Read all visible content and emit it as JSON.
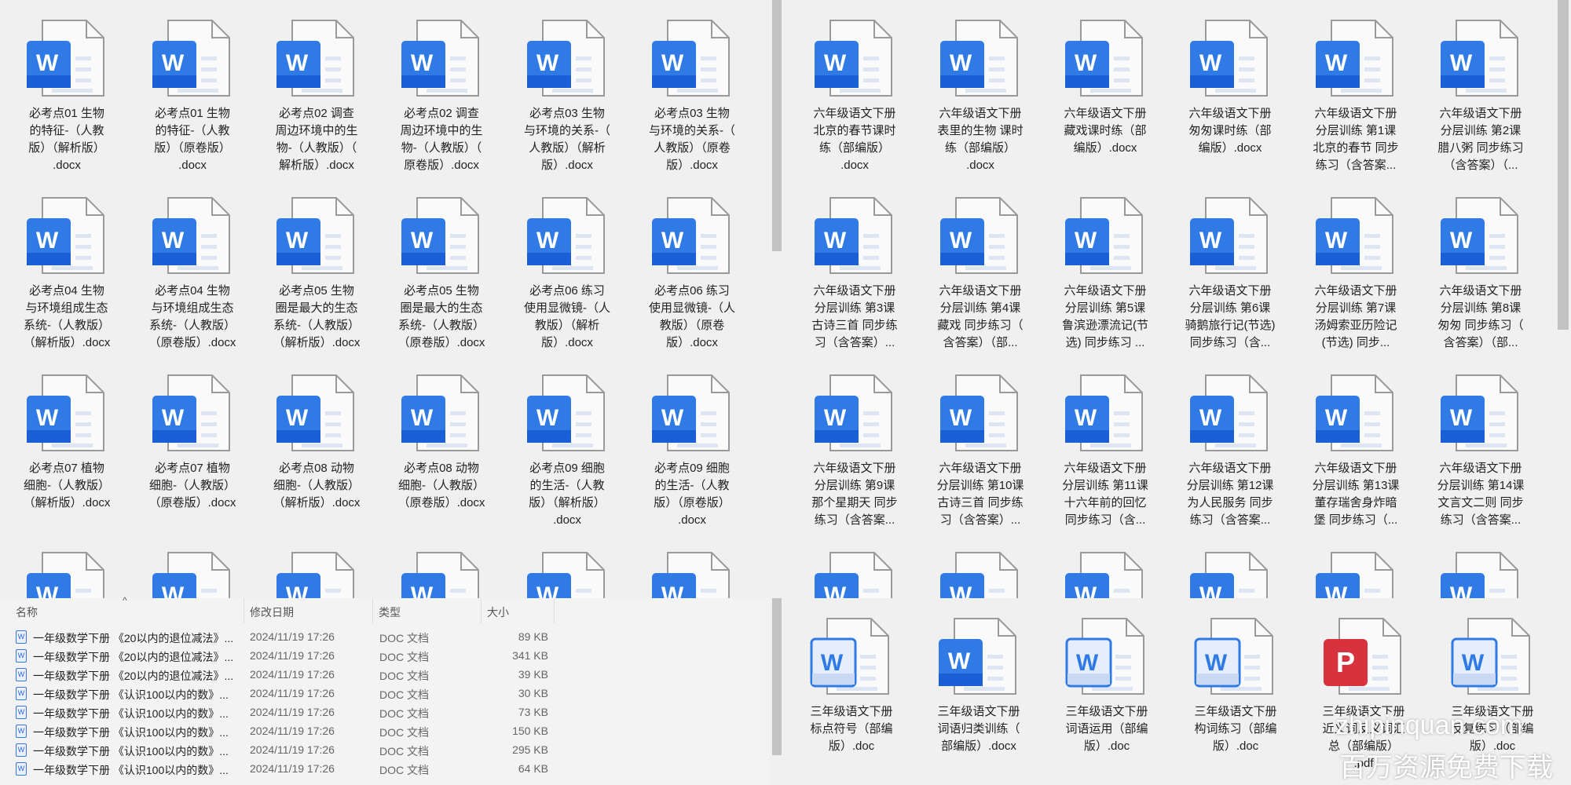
{
  "left_grid": [
    "必考点01  生物\n的特征-（人教\n版）（解析版）\n.docx",
    "必考点01  生物\n的特征-（人教\n版）（原卷版）\n.docx",
    "必考点02  调查\n周边环境中的生\n物-（人教版）（\n解析版）.docx",
    "必考点02  调查\n周边环境中的生\n物-（人教版）（\n原卷版）.docx",
    "必考点03  生物\n与环境的关系-（\n人教版）（解析\n版）.docx",
    "必考点03  生物\n与环境的关系-（\n人教版）（原卷\n版）.docx",
    "必考点04  生物\n与环境组成生态\n系统-（人教版）\n（解析版）.docx",
    "必考点04  生物\n与环境组成生态\n系统-（人教版）\n（原卷版）.docx",
    "必考点05  生物\n圈是最大的生态\n系统-（人教版）\n（解析版）.docx",
    "必考点05  生物\n圈是最大的生态\n系统-（人教版）\n（原卷版）.docx",
    "必考点06  练习\n使用显微镜-（人\n教版）（解析\n版）.docx",
    "必考点06  练习\n使用显微镜-（人\n教版）（原卷\n版）.docx",
    "必考点07  植物\n细胞-（人教版）\n（解析版）.docx",
    "必考点07  植物\n细胞-（人教版）\n（原卷版）.docx",
    "必考点08  动物\n细胞-（人教版）\n（解析版）.docx",
    "必考点08  动物\n细胞-（人教版）\n（原卷版）.docx",
    "必考点09  细胞\n的生活-（人教\n版）（解析版）\n.docx",
    "必考点09  细胞\n的生活-（人教\n版）（原卷版）\n.docx",
    "",
    "",
    "",
    "",
    "",
    ""
  ],
  "right_grid": [
    "六年级语文下册\n北京的春节课时\n练（部编版）\n.docx",
    "六年级语文下册\n表里的生物 课时\n练（部编版）\n.docx",
    "六年级语文下册\n藏戏课时练（部\n编版）.docx",
    "六年级语文下册\n匆匆课时练（部\n编版）.docx",
    "六年级语文下册\n分层训练 第1课\n北京的春节 同步\n练习（含答案...",
    "六年级语文下册\n分层训练 第2课\n腊八粥 同步练习\n（含答案）（...",
    "六年级语文下册\n分层训练 第3课\n古诗三首 同步练\n习（含答案）...",
    "六年级语文下册\n分层训练 第4课\n藏戏 同步练习（\n含答案）（部...",
    "六年级语文下册\n分层训练 第5课\n鲁滨逊漂流记(节\n选) 同步练习 ...",
    "六年级语文下册\n分层训练 第6课\n骑鹅旅行记(节选)\n同步练习（含...",
    "六年级语文下册\n分层训练 第7课\n汤姆索亚历险记\n(节选) 同步...",
    "六年级语文下册\n分层训练 第8课\n匆匆 同步练习（\n含答案）（部...",
    "六年级语文下册\n分层训练 第9课\n那个星期天 同步\n练习（含答案...",
    "六年级语文下册\n分层训练 第10课\n古诗三首 同步练\n习（含答案）...",
    "六年级语文下册\n分层训练 第11课\n十六年前的回忆\n同步练习（含...",
    "六年级语文下册\n分层训练 第12课\n为人民服务 同步\n练习（含答案...",
    "六年级语文下册\n分层训练 第13课\n董存瑞舍身炸暗\n堡 同步练习（...",
    "六年级语文下册\n分层训练 第14课\n文言文二则 同步\n练习（含答案...",
    "",
    "",
    "",
    "",
    "",
    ""
  ],
  "bottom_right": [
    {
      "label": "三年级语文下册\n标点符号（部编\n版）.doc",
      "type": "doc"
    },
    {
      "label": "三年级语文下册\n词语归类训练（\n部编版）.docx",
      "type": "docx"
    },
    {
      "label": "三年级语文下册\n词语运用（部编\n版）.doc",
      "type": "doc"
    },
    {
      "label": "三年级语文下册\n构词练习（部编\n版）.doc",
      "type": "doc"
    },
    {
      "label": "三年级语文下册\n近义词反义词汇\n总（部编版）\n.pdf",
      "type": "pdf"
    },
    {
      "label": "三年级语文下册\n反复练习（部编\n版）.doc",
      "type": "doc"
    }
  ],
  "details": {
    "columns": {
      "name": "名称",
      "date": "修改日期",
      "type": "类型",
      "size": "大小"
    },
    "rows": [
      {
        "name": "一年级数学下册 《20以内的退位减法》...",
        "date": "2024/11/19 17:26",
        "type": "DOC 文档",
        "size": "89 KB"
      },
      {
        "name": "一年级数学下册 《20以内的退位减法》...",
        "date": "2024/11/19 17:26",
        "type": "DOC 文档",
        "size": "341 KB"
      },
      {
        "name": "一年级数学下册 《20以内的退位减法》...",
        "date": "2024/11/19 17:26",
        "type": "DOC 文档",
        "size": "39 KB"
      },
      {
        "name": "一年级数学下册 《认识100以内的数》...",
        "date": "2024/11/19 17:26",
        "type": "DOC 文档",
        "size": "30 KB"
      },
      {
        "name": "一年级数学下册 《认识100以内的数》...",
        "date": "2024/11/19 17:26",
        "type": "DOC 文档",
        "size": "73 KB"
      },
      {
        "name": "一年级数学下册 《认识100以内的数》...",
        "date": "2024/11/19 17:26",
        "type": "DOC 文档",
        "size": "150 KB"
      },
      {
        "name": "一年级数学下册 《认识100以内的数》...",
        "date": "2024/11/19 17:26",
        "type": "DOC 文档",
        "size": "295 KB"
      },
      {
        "name": "一年级数学下册 《认识100以内的数》...",
        "date": "2024/11/19 17:26",
        "type": "DOC 文档",
        "size": "64 KB"
      }
    ]
  },
  "watermark": {
    "site": "zhipinquan.com",
    "slogan": "百万资源免费下载"
  },
  "colors": {
    "word": "#1a5fd6",
    "word_light": "#2f7ae5",
    "pdf": "#d9323f"
  }
}
